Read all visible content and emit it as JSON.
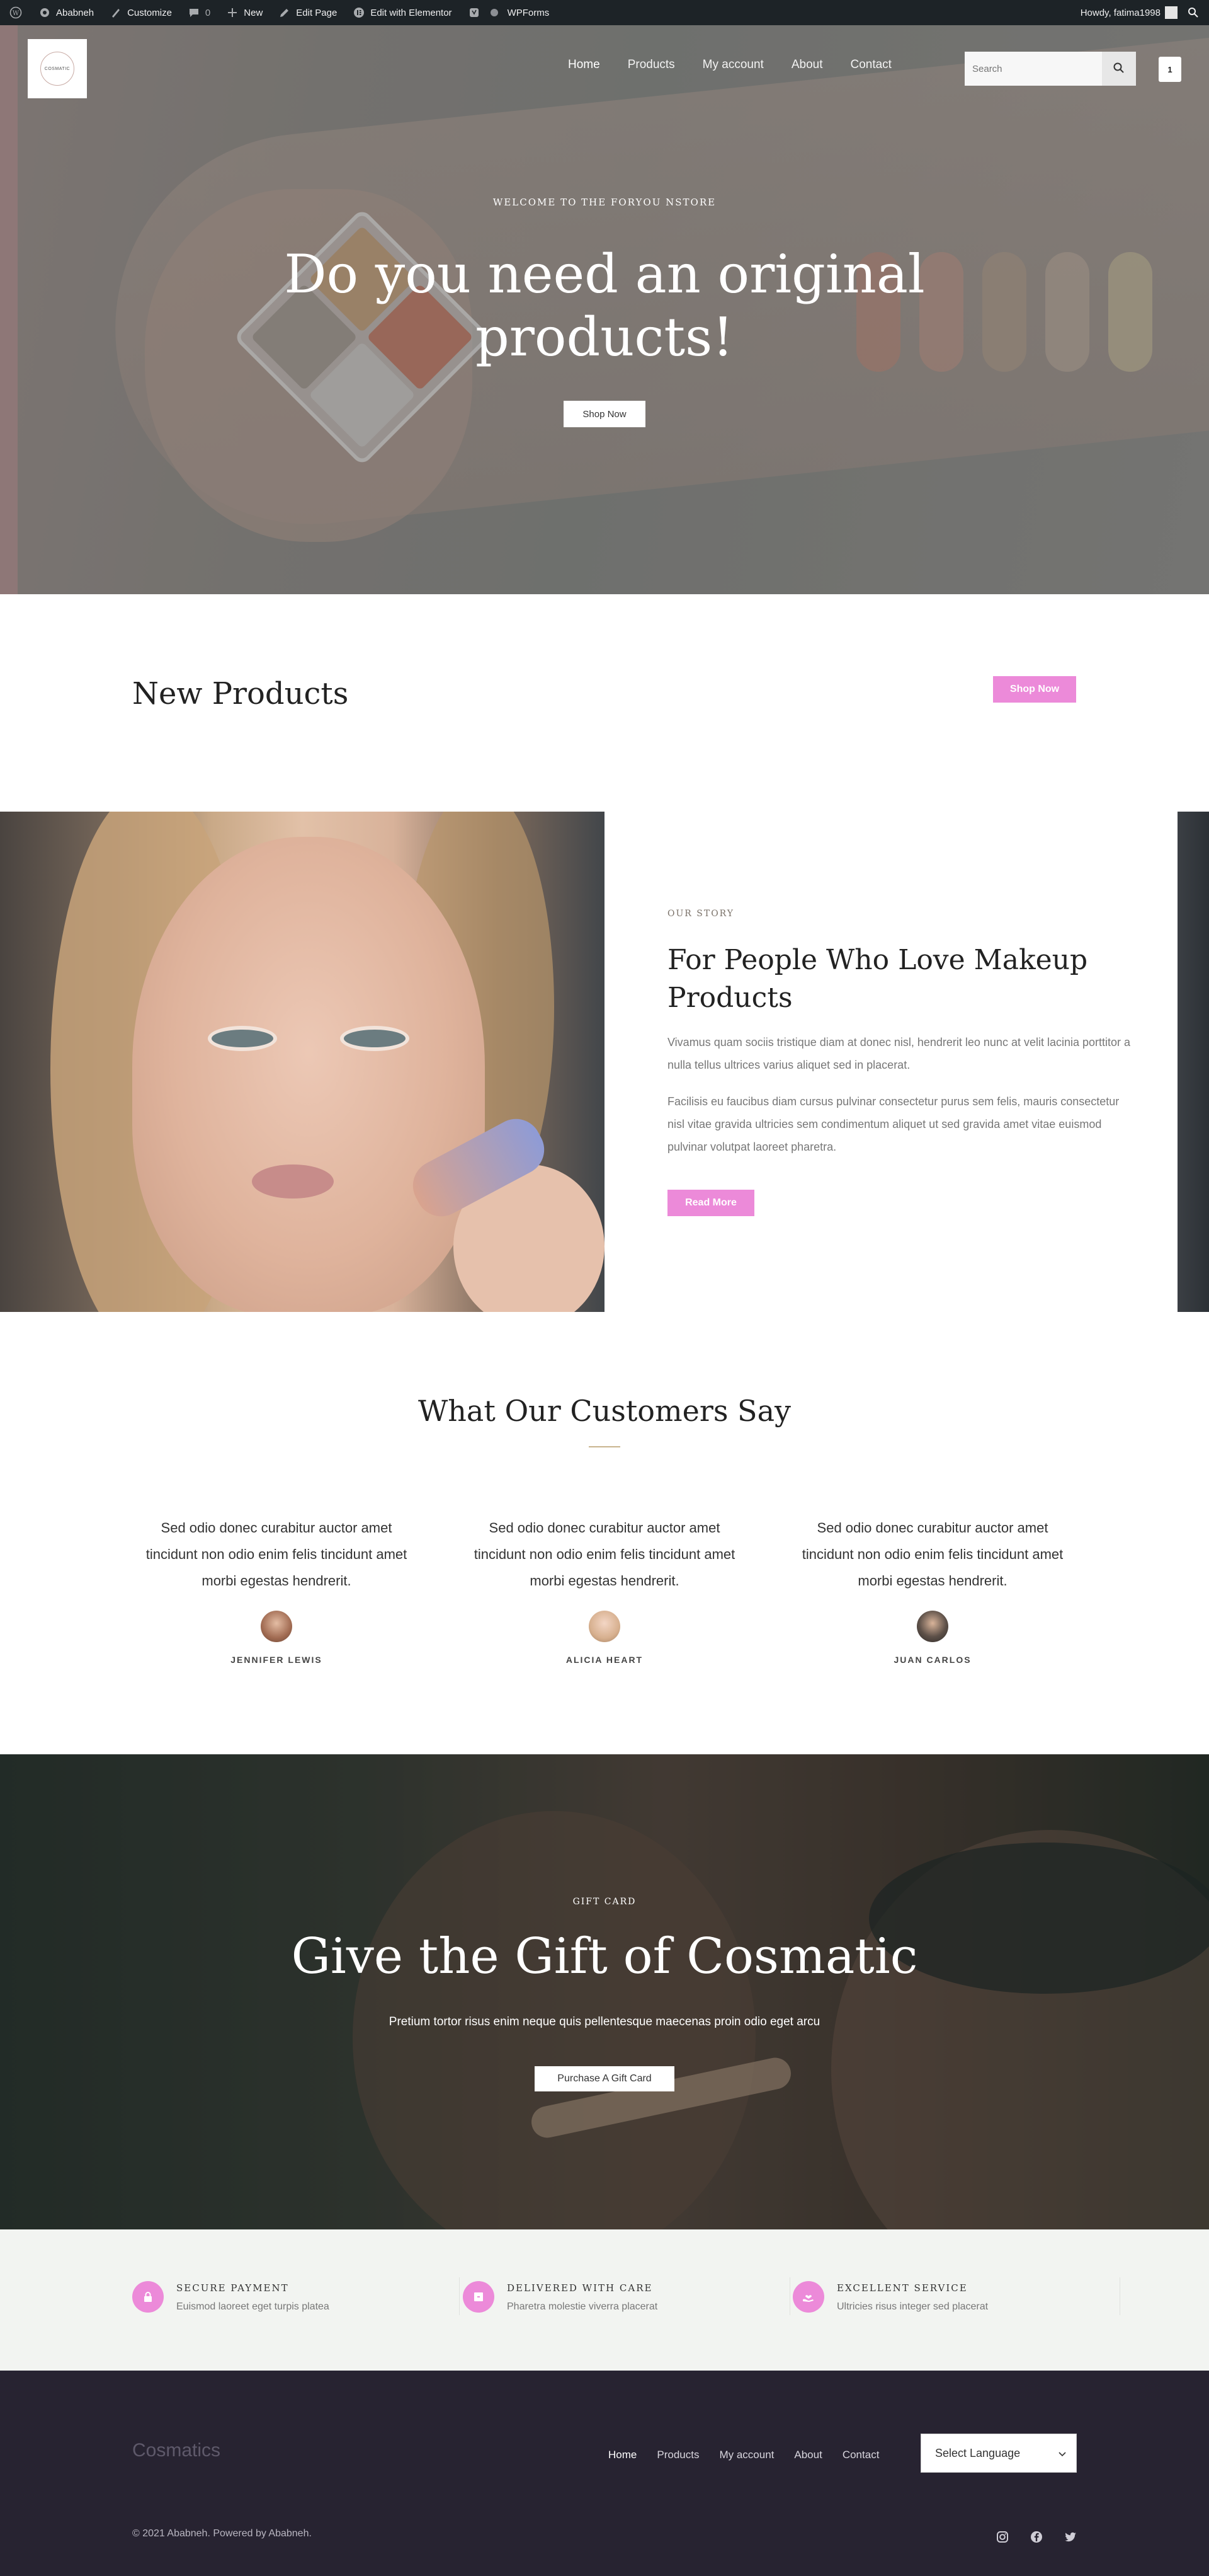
{
  "admin_bar": {
    "site_name": "Ababneh",
    "customize": "Customize",
    "comments_count": "0",
    "new": "New",
    "edit_page": "Edit Page",
    "edit_elementor": "Edit with Elementor",
    "wpforms": "WPForms",
    "howdy": "Howdy, fatima1998"
  },
  "header": {
    "logo_text": "COSMATIC",
    "nav": [
      "Home",
      "Products",
      "My account",
      "About",
      "Contact"
    ],
    "active_nav": "Home",
    "search_placeholder": "Search",
    "cart_count": "1"
  },
  "hero": {
    "kicker": "WELCOME TO THE FORYOU NSTORE",
    "title_line1": "Do you need an original",
    "title_line2": "products!",
    "button": "Shop Now"
  },
  "new_products": {
    "title": "New Products",
    "button": "Shop Now"
  },
  "story": {
    "kicker": "OUR STORY",
    "title": "For People Who Love Makeup Products",
    "p1": "Vivamus quam sociis tristique diam at donec nisl, hendrerit leo nunc at velit lacinia porttitor a nulla tellus ultrices varius aliquet sed in placerat.",
    "p2": "Facilisis eu faucibus diam cursus pulvinar consectetur purus sem felis, mauris consectetur nisl vitae gravida ultricies sem condimentum aliquet ut sed gravida amet vitae euismod pulvinar volutpat laoreet pharetra.",
    "button": "Read More"
  },
  "testimonials": {
    "title": "What Our Customers Say",
    "items": [
      {
        "quote": "Sed odio donec curabitur auctor amet tincidunt non odio enim felis tincidunt amet morbi egestas hendrerit.",
        "name": "JENNIFER LEWIS"
      },
      {
        "quote": "Sed odio donec curabitur auctor amet tincidunt non odio enim felis tincidunt amet morbi egestas hendrerit.",
        "name": "ALICIA HEART"
      },
      {
        "quote": "Sed odio donec curabitur auctor amet tincidunt non odio enim felis tincidunt amet morbi egestas hendrerit.",
        "name": "JUAN CARLOS"
      }
    ]
  },
  "gift": {
    "kicker": "GIFT CARD",
    "title": "Give the Gift of Cosmatic",
    "subtitle": "Pretium tortor risus enim neque quis pellentesque maecenas proin odio eget arcu",
    "button": "Purchase A Gift Card"
  },
  "features": [
    {
      "icon": "lock-icon",
      "title": "SECURE PAYMENT",
      "desc": "Euismod laoreet eget turpis platea"
    },
    {
      "icon": "box-icon",
      "title": "DELIVERED WITH CARE",
      "desc": "Pharetra molestie viverra placerat"
    },
    {
      "icon": "hand-heart-icon",
      "title": "EXCELLENT SERVICE",
      "desc": "Ultricies risus integer sed placerat"
    }
  ],
  "footer": {
    "brand": "Cosmatics",
    "nav": [
      "Home",
      "Products",
      "My account",
      "About",
      "Contact"
    ],
    "language": "Select Language",
    "copyright": "© 2021 Ababneh. Powered by Ababneh."
  },
  "colors": {
    "accent_pink": "#ec8ad9",
    "admin_bar": "#1d2327",
    "footer_bg": "#272331",
    "features_bg": "#f2f4f1"
  }
}
